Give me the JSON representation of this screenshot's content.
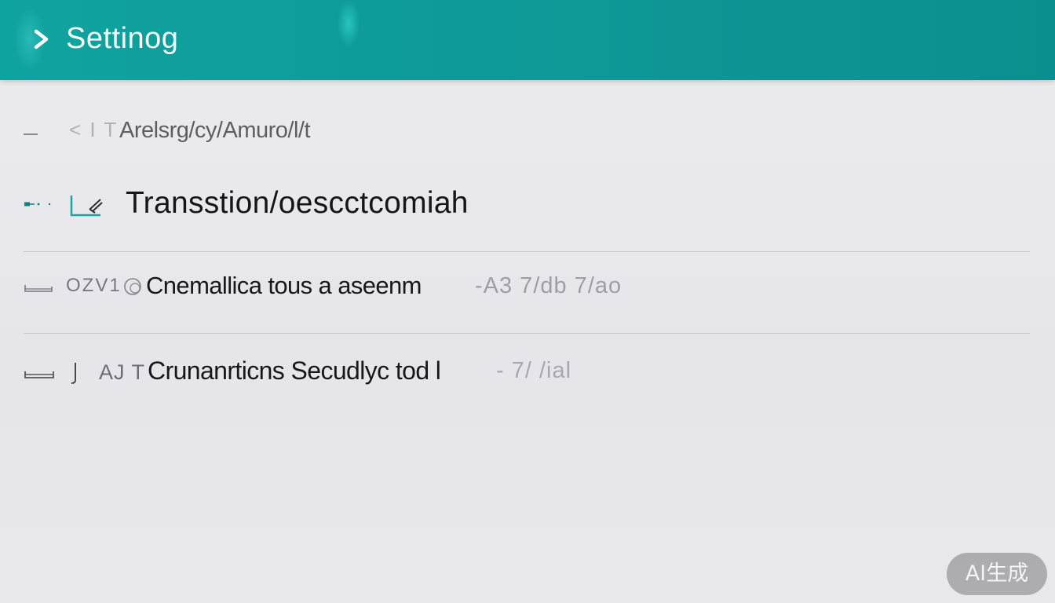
{
  "header": {
    "title": "Settinog",
    "back_icon": "chevron-right-icon",
    "background": "#0e9a98",
    "title_color": "#f4fbfb"
  },
  "rows": [
    {
      "prefix": "< I T",
      "label": "Arelsrg/cy/Amuro/l/t",
      "lead_icon": "dash-icon"
    },
    {
      "label": "Transstion/oescctcomiah",
      "lead_icon": "slider-dots-icon",
      "tile_icon": "edit-tile-icon",
      "accent": "#0fa3a0"
    },
    {
      "code": "OZV1",
      "label": "Cnemallica tous a aseenm",
      "trail": "-A3 7/db 7/ao",
      "lead_icon": "tray-icon",
      "ring_icon": "ring-icon"
    },
    {
      "code": "AJ T",
      "label": "Crunanrticns Secudlyc tod l",
      "trail": "- 7/ /ial",
      "lead_icon": "tray-icon",
      "bar_icon": "bar-icon"
    }
  ],
  "watermark": {
    "text": "AI生成"
  }
}
